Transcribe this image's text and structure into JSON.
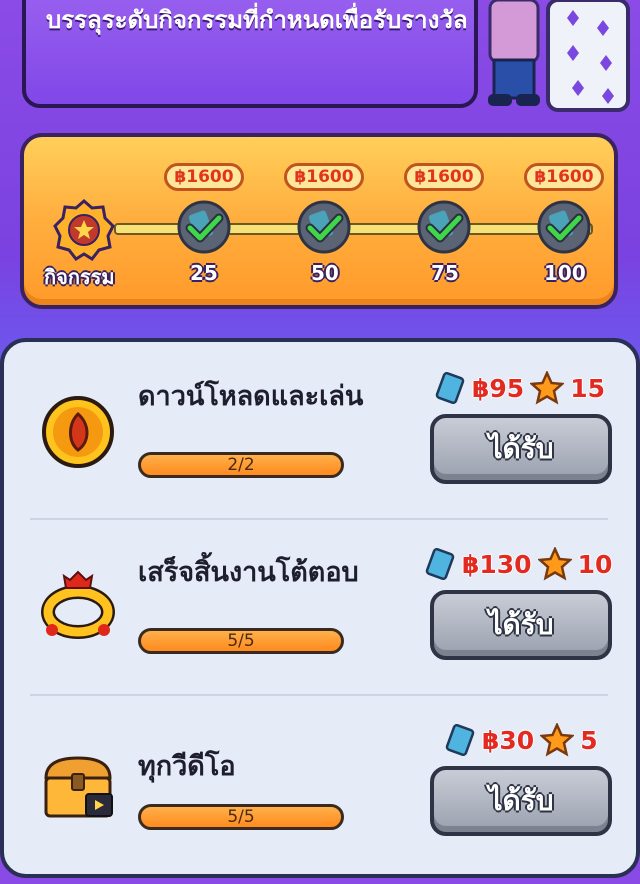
{
  "banner": {
    "text": "บรรลุระดับกิจกรรมที่กำหนดเพื่อรับรางวัล"
  },
  "milestones": {
    "label": "กิจกรรม",
    "steps": [
      {
        "reward": "฿1600",
        "level": "25"
      },
      {
        "reward": "฿1600",
        "level": "50"
      },
      {
        "reward": "฿1600",
        "level": "75"
      },
      {
        "reward": "฿1600",
        "level": "100"
      }
    ]
  },
  "tasks": [
    {
      "title": "ดาวน์โหลดและเล่น",
      "progress": "2/2",
      "cash": "฿95",
      "stars": "15",
      "claim": "ได้รับ",
      "icon": "orange-orb-icon"
    },
    {
      "title": "เสร็จสิ้นงานโต้ตอบ",
      "progress": "5/5",
      "cash": "฿130",
      "stars": "10",
      "claim": "ได้รับ",
      "icon": "ring-icon"
    },
    {
      "title": "ทุกวีดีโอ",
      "progress": "5/5",
      "cash": "฿30",
      "stars": "5",
      "claim": "ได้รับ",
      "icon": "treasure-chest-icon"
    }
  ],
  "colors": {
    "accent": "#ff9a2a",
    "reward_text": "#e22a20",
    "panel_bg": "#e6ecf7"
  }
}
